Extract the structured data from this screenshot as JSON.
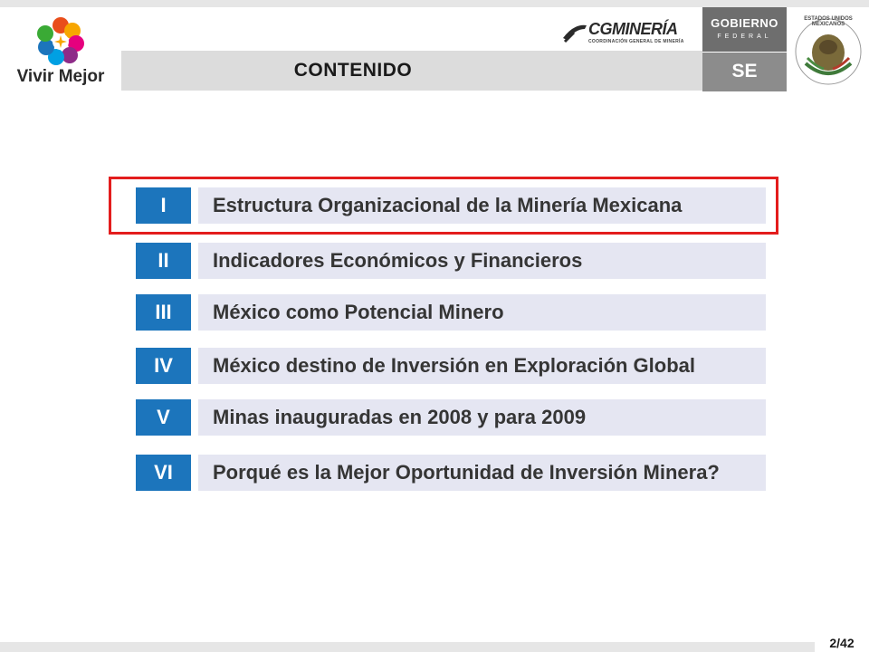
{
  "header": {
    "title": "CONTENIDO",
    "left_logo_text": "Vivir Mejor",
    "cg_logo_name": "CGMINERÍA",
    "cg_logo_sub": "COORDINACIÓN GENERAL DE MINERÍA",
    "gobierno_title": "GOBIERNO",
    "gobierno_sub": "FEDERAL",
    "se_label": "SE",
    "seal_text": "ESTADOS UNIDOS MEXICANOS"
  },
  "items": [
    {
      "numeral": "I",
      "label": "Estructura  Organizacional de la Minería Mexicana"
    },
    {
      "numeral": "II",
      "label": "Indicadores Económicos y Financieros"
    },
    {
      "numeral": "III",
      "label": "México como Potencial Minero"
    },
    {
      "numeral": "IV",
      "label": "México destino de Inversión en Exploración Global"
    },
    {
      "numeral": "V",
      "label": "Minas inauguradas en 2008 y para 2009"
    },
    {
      "numeral": "VI",
      "label": "Porqué es la Mejor Oportunidad de Inversión Minera?"
    }
  ],
  "footer": {
    "page": "2/42"
  },
  "colors": {
    "numeral_box": "#1c75bc",
    "label_box": "#e5e6f2",
    "highlight_border": "#e31d1d",
    "header_band": "#dcdcdc"
  }
}
